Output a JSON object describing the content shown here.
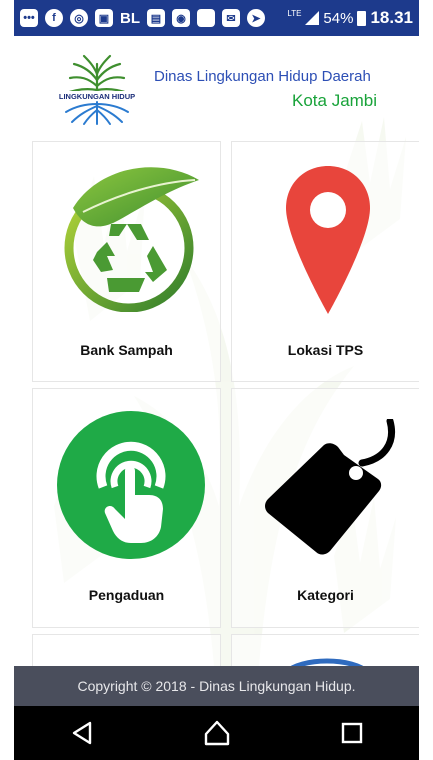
{
  "status_bar": {
    "app_icons": [
      "chat-icon",
      "facebook-icon",
      "app-icon",
      "gallery-icon"
    ],
    "bl_label": "BL",
    "network_label": "LTE",
    "battery_percent": "54%",
    "time": "18.31"
  },
  "header": {
    "logo_text": "LINGKUNGAN HIDUP",
    "title": "Dinas Lingkungan Hidup Daerah",
    "subtitle": "Kota Jambi"
  },
  "menu": {
    "items": [
      {
        "label": "Bank Sampah",
        "icon": "recycle-icon"
      },
      {
        "label": "Lokasi TPS",
        "icon": "location-pin-icon"
      },
      {
        "label": "Pengaduan",
        "icon": "touch-icon"
      },
      {
        "label": "Kategori",
        "icon": "tag-icon"
      }
    ]
  },
  "footer": {
    "copyright": "Copyright © 2018 - Dinas Lingkungan Hidup."
  },
  "colors": {
    "status_bar": "#1d3a8c",
    "title_blue": "#2d4fb5",
    "subtitle_green": "#19a33a",
    "footer_bg": "#4a4e5c",
    "pin_red": "#e8453c",
    "touch_green": "#1faa47"
  }
}
